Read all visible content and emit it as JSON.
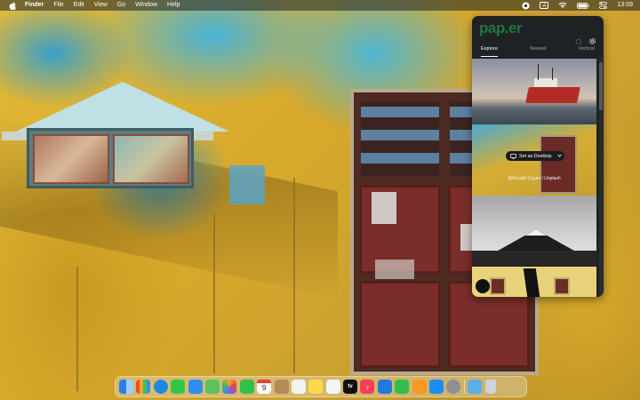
{
  "menubar": {
    "app_name": "Finder",
    "items": [
      "File",
      "Edit",
      "View",
      "Go",
      "Window",
      "Help"
    ],
    "clock": "13:09",
    "status_icons": [
      "paper-app-icon",
      "text-input-icon",
      "wifi-icon",
      "battery-icon",
      "control-center-icon"
    ],
    "input_source_label": "A"
  },
  "panel": {
    "brand": "pap.er",
    "tabs": [
      "Explore",
      "Newest",
      "Vertical"
    ],
    "active_tab": "Explore",
    "set_desktop_label": "Set as Desktop",
    "photo_credit": "@Ronald Cuyan / Unplash"
  },
  "dock": {
    "calendar_day": "9",
    "tv_label": "tv",
    "apps": [
      {
        "name": "finder-icon",
        "color": "#2b7de9"
      },
      {
        "name": "launchpad-icon",
        "color": "#e8e8e8"
      },
      {
        "name": "safari-icon",
        "color": "#1e88e5"
      },
      {
        "name": "messages-icon",
        "color": "#33c748"
      },
      {
        "name": "mail-icon",
        "color": "#2f8df0"
      },
      {
        "name": "maps-icon",
        "color": "#5cc25b"
      },
      {
        "name": "photos-icon",
        "color": "#f5a623"
      },
      {
        "name": "facetime-icon",
        "color": "#2fc14b"
      },
      {
        "name": "calendar-icon",
        "color": "#ffffff"
      },
      {
        "name": "contacts-icon",
        "color": "#b48a5a"
      },
      {
        "name": "reminders-icon",
        "color": "#f2f2f2"
      },
      {
        "name": "notes-icon",
        "color": "#ffd84a"
      },
      {
        "name": "freeform-icon",
        "color": "#f4f4f4"
      },
      {
        "name": "apple-tv-icon",
        "color": "#111111"
      },
      {
        "name": "music-icon",
        "color": "#fa3c57"
      },
      {
        "name": "keynote-icon",
        "color": "#1f7ae0"
      },
      {
        "name": "numbers-icon",
        "color": "#2fbf4a"
      },
      {
        "name": "pages-icon",
        "color": "#f79a1e"
      },
      {
        "name": "app-store-icon",
        "color": "#1e8cf5"
      },
      {
        "name": "system-settings-icon",
        "color": "#8e8e93"
      },
      {
        "name": "downloads-folder-icon",
        "color": "#5ab0e8"
      },
      {
        "name": "trash-icon",
        "color": "#cfd3d6"
      }
    ]
  }
}
